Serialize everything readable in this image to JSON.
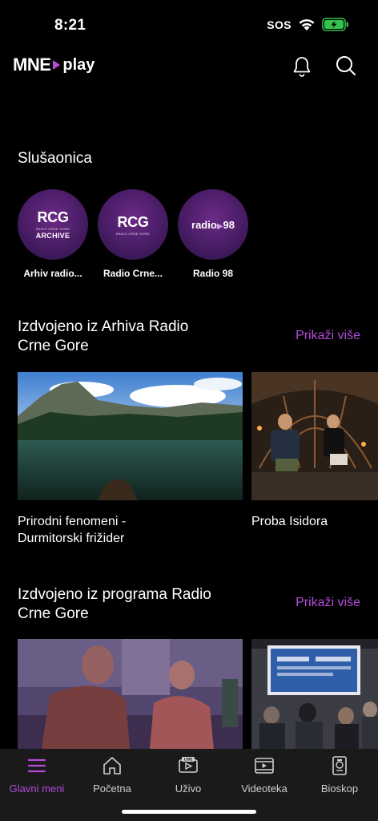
{
  "status_bar": {
    "time": "8:21",
    "sos": "SOS"
  },
  "header": {
    "logo_main": "MNE",
    "logo_sub": "play"
  },
  "listening": {
    "title": "Slušaonica",
    "stations": [
      {
        "logo_text": "RCG",
        "logo_caption": "ARCHIVE",
        "label": "Arhiv radio..."
      },
      {
        "logo_text": "RCG",
        "label": "Radio Crne..."
      },
      {
        "logo_text": "radio 98",
        "label": "Radio 98"
      }
    ]
  },
  "archive_section": {
    "title_line1": "Izdvojeno iz Arhiva Radio",
    "title_line2": "Crne Gore",
    "show_more": "Prikaži više",
    "cards": [
      {
        "title_line1": "Prirodni fenomeni -",
        "title_line2": "Durmitorski frižider"
      },
      {
        "title_line1": "Proba Isidora",
        "title_line2": ""
      }
    ]
  },
  "program_section": {
    "title_line1": "Izdvojeno iz programa Radio",
    "title_line2": "Crne Gore",
    "show_more": "Prikaži više"
  },
  "bottom_nav": {
    "items": [
      {
        "label": "Glavni meni",
        "icon": "menu-icon",
        "active": true
      },
      {
        "label": "Početna",
        "icon": "home-icon"
      },
      {
        "label": "Uživo",
        "icon": "live-tv-icon"
      },
      {
        "label": "Videoteka",
        "icon": "video-library-icon"
      },
      {
        "label": "Bioskop",
        "icon": "cinema-icon"
      }
    ]
  },
  "colors": {
    "accent": "#b64ad8",
    "background": "#000000",
    "nav_background": "#1a1a1a"
  }
}
